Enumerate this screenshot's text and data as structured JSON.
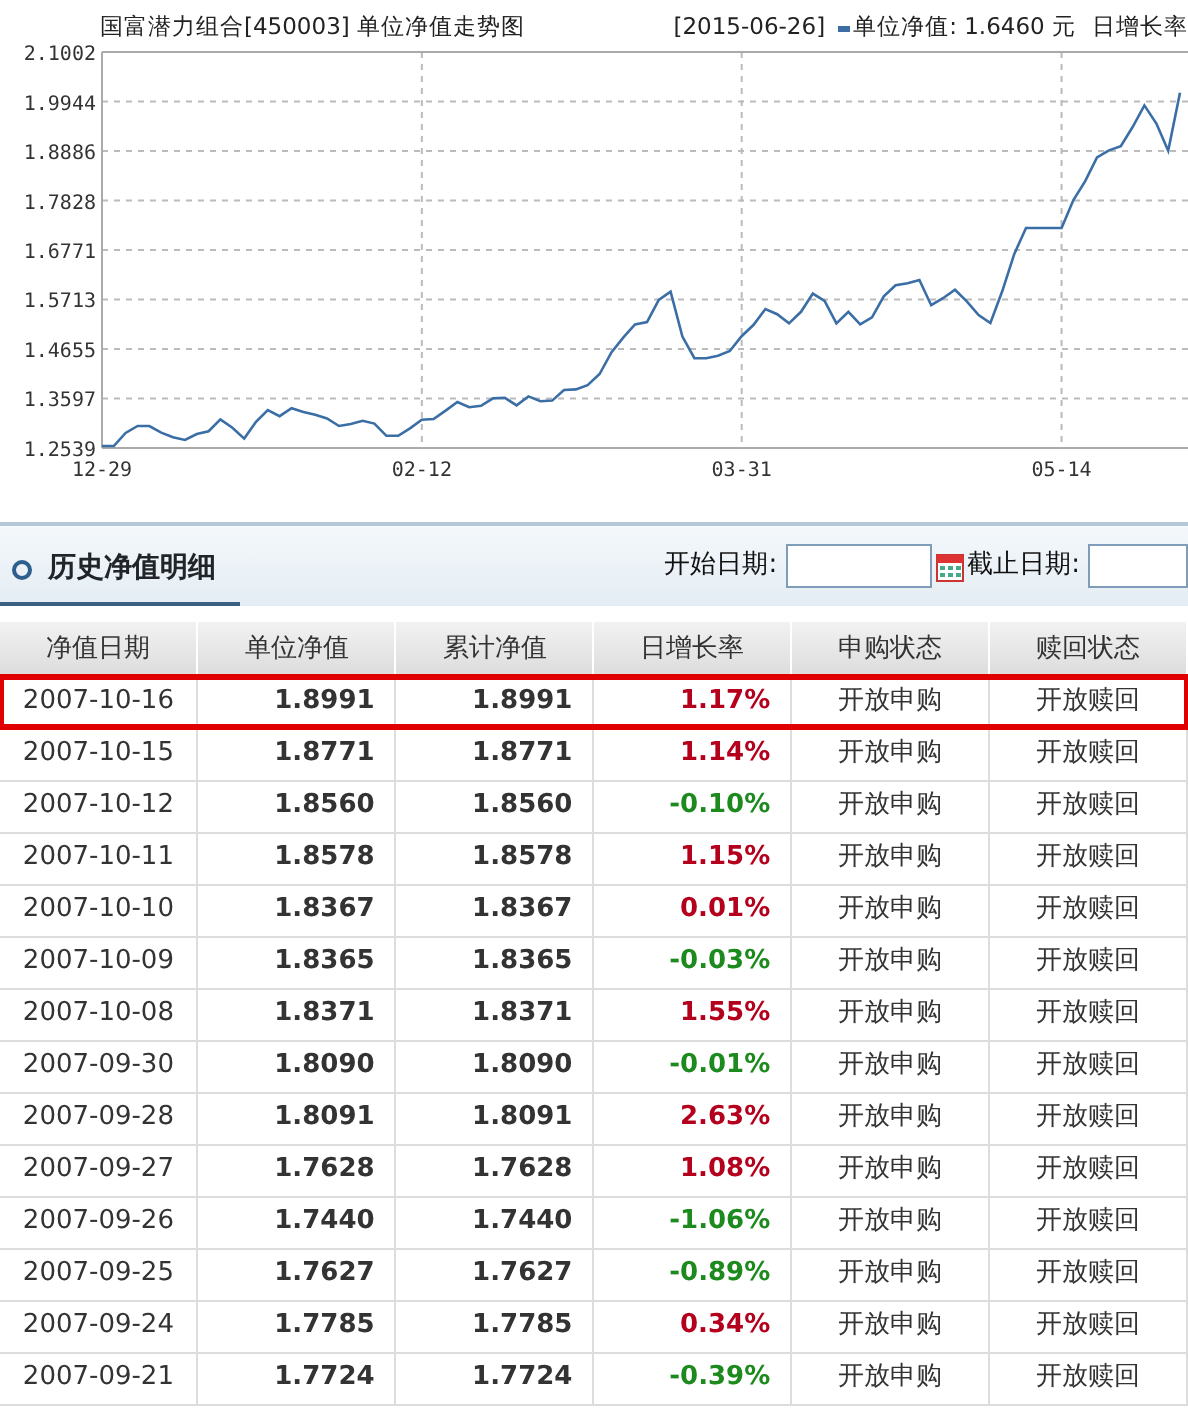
{
  "chart": {
    "title": "国富潜力组合[450003] 单位净值走势图",
    "date": "[2015-06-26]",
    "legend_value": ": 1.6460 元",
    "legend_extra": "日增长率",
    "chart_data": {
      "type": "line",
      "grid": true,
      "ylim": [
        1.2539,
        2.1002
      ],
      "yticks": [
        1.2539,
        1.3597,
        1.4655,
        1.5713,
        1.6771,
        1.7828,
        1.8886,
        1.9944,
        2.1002
      ],
      "categories": [
        "12-29",
        null,
        null,
        null,
        null,
        null,
        null,
        null,
        null,
        null,
        null,
        null,
        null,
        null,
        null,
        null,
        null,
        null,
        null,
        null,
        null,
        null,
        null,
        null,
        null,
        null,
        null,
        "02-12",
        null,
        null,
        null,
        null,
        null,
        null,
        null,
        null,
        null,
        null,
        null,
        null,
        null,
        null,
        null,
        null,
        null,
        null,
        null,
        null,
        null,
        null,
        null,
        null,
        null,
        null,
        "03-31",
        null,
        null,
        null,
        null,
        null,
        null,
        null,
        null,
        null,
        null,
        null,
        null,
        null,
        null,
        null,
        null,
        null,
        null,
        null,
        null,
        null,
        null,
        null,
        null,
        null,
        null,
        "05-14",
        null,
        null,
        null,
        null,
        null,
        null,
        null,
        null,
        null,
        null
      ],
      "series": [
        {
          "name": "单位净值",
          "color": "#3a6ea5",
          "values": [
            1.258,
            1.258,
            1.286,
            1.301,
            1.301,
            1.287,
            1.277,
            1.271,
            1.284,
            1.29,
            1.315,
            1.297,
            1.274,
            1.31,
            1.335,
            1.322,
            1.339,
            1.331,
            1.325,
            1.317,
            1.301,
            1.305,
            1.312,
            1.306,
            1.28,
            1.28,
            1.296,
            1.314,
            1.316,
            1.334,
            1.352,
            1.341,
            1.344,
            1.36,
            1.361,
            1.345,
            1.364,
            1.354,
            1.355,
            1.378,
            1.379,
            1.388,
            1.412,
            1.458,
            1.49,
            1.518,
            1.523,
            1.57,
            1.588,
            1.492,
            1.446,
            1.446,
            1.451,
            1.461,
            1.493,
            1.517,
            1.551,
            1.54,
            1.52,
            1.545,
            1.584,
            1.568,
            1.52,
            1.545,
            1.518,
            1.533,
            1.578,
            1.602,
            1.606,
            1.613,
            1.559,
            1.574,
            1.592,
            1.567,
            1.538,
            1.521,
            1.59,
            1.668,
            1.724,
            1.724,
            1.724,
            1.724,
            1.784,
            1.824,
            1.875,
            1.89,
            1.899,
            1.94,
            1.986,
            1.947,
            1.889,
            2.013
          ]
        }
      ]
    }
  },
  "section": {
    "title": "历史净值明细",
    "start_label": "开始日期:",
    "end_label": "截止日期:"
  },
  "table": {
    "columns": [
      "净值日期",
      "单位净值",
      "累计净值",
      "日增长率",
      "申购状态",
      "赎回状态"
    ],
    "rows": [
      {
        "date": "2007-10-16",
        "nav": "1.8991",
        "acc": "1.8991",
        "rate": "1.17%",
        "color": "#b5001d",
        "buy": "开放申购",
        "redeem": "开放赎回",
        "highlighted": true
      },
      {
        "date": "2007-10-15",
        "nav": "1.8771",
        "acc": "1.8771",
        "rate": "1.14%",
        "color": "#b5001d",
        "buy": "开放申购",
        "redeem": "开放赎回",
        "highlighted": false
      },
      {
        "date": "2007-10-12",
        "nav": "1.8560",
        "acc": "1.8560",
        "rate": "-0.10%",
        "color": "#1d8a1d",
        "buy": "开放申购",
        "redeem": "开放赎回",
        "highlighted": false
      },
      {
        "date": "2007-10-11",
        "nav": "1.8578",
        "acc": "1.8578",
        "rate": "1.15%",
        "color": "#b5001d",
        "buy": "开放申购",
        "redeem": "开放赎回",
        "highlighted": false
      },
      {
        "date": "2007-10-10",
        "nav": "1.8367",
        "acc": "1.8367",
        "rate": "0.01%",
        "color": "#b5001d",
        "buy": "开放申购",
        "redeem": "开放赎回",
        "highlighted": false
      },
      {
        "date": "2007-10-09",
        "nav": "1.8365",
        "acc": "1.8365",
        "rate": "-0.03%",
        "color": "#1d8a1d",
        "buy": "开放申购",
        "redeem": "开放赎回",
        "highlighted": false
      },
      {
        "date": "2007-10-08",
        "nav": "1.8371",
        "acc": "1.8371",
        "rate": "1.55%",
        "color": "#b5001d",
        "buy": "开放申购",
        "redeem": "开放赎回",
        "highlighted": false
      },
      {
        "date": "2007-09-30",
        "nav": "1.8090",
        "acc": "1.8090",
        "rate": "-0.01%",
        "color": "#1d8a1d",
        "buy": "开放申购",
        "redeem": "开放赎回",
        "highlighted": false
      },
      {
        "date": "2007-09-28",
        "nav": "1.8091",
        "acc": "1.8091",
        "rate": "2.63%",
        "color": "#b5001d",
        "buy": "开放申购",
        "redeem": "开放赎回",
        "highlighted": false
      },
      {
        "date": "2007-09-27",
        "nav": "1.7628",
        "acc": "1.7628",
        "rate": "1.08%",
        "color": "#b5001d",
        "buy": "开放申购",
        "redeem": "开放赎回",
        "highlighted": false
      },
      {
        "date": "2007-09-26",
        "nav": "1.7440",
        "acc": "1.7440",
        "rate": "-1.06%",
        "color": "#1d8a1d",
        "buy": "开放申购",
        "redeem": "开放赎回",
        "highlighted": false
      },
      {
        "date": "2007-09-25",
        "nav": "1.7627",
        "acc": "1.7627",
        "rate": "-0.89%",
        "color": "#1d8a1d",
        "buy": "开放申购",
        "redeem": "开放赎回",
        "highlighted": false
      },
      {
        "date": "2007-09-24",
        "nav": "1.7785",
        "acc": "1.7785",
        "rate": "0.34%",
        "color": "#b5001d",
        "buy": "开放申购",
        "redeem": "开放赎回",
        "highlighted": false
      },
      {
        "date": "2007-09-21",
        "nav": "1.7724",
        "acc": "1.7724",
        "rate": "-0.39%",
        "color": "#1d8a1d",
        "buy": "开放申购",
        "redeem": "开放赎回",
        "highlighted": false
      }
    ]
  }
}
